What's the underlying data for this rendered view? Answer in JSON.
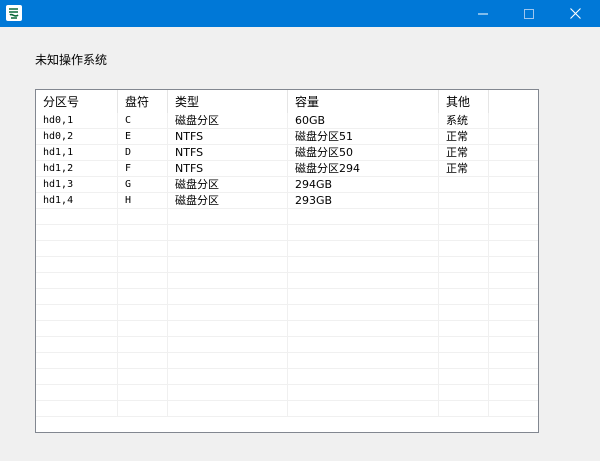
{
  "window": {
    "minimize_icon": "minimize-icon",
    "maximize_icon": "maximize-icon",
    "close_icon": "close-icon",
    "app_icon": "app-icon",
    "accent": "#0078d7"
  },
  "os_label": "未知操作系统",
  "table": {
    "columns": [
      "分区号",
      "盘符",
      "类型",
      "容量",
      "其他"
    ],
    "rows": [
      [
        "hd0,1",
        "C",
        "磁盘分区",
        "60GB",
        "系统"
      ],
      [
        "hd0,2",
        "E",
        "NTFS",
        "磁盘分区51",
        "正常"
      ],
      [
        "hd1,1",
        "D",
        "NTFS",
        "磁盘分区50",
        "正常"
      ],
      [
        "hd1,2",
        "F",
        "NTFS",
        "磁盘分区294",
        "正常"
      ],
      [
        "hd1,3",
        "G",
        "磁盘分区",
        "294GB",
        ""
      ],
      [
        "hd1,4",
        "H",
        "磁盘分区",
        "293GB",
        ""
      ]
    ]
  }
}
